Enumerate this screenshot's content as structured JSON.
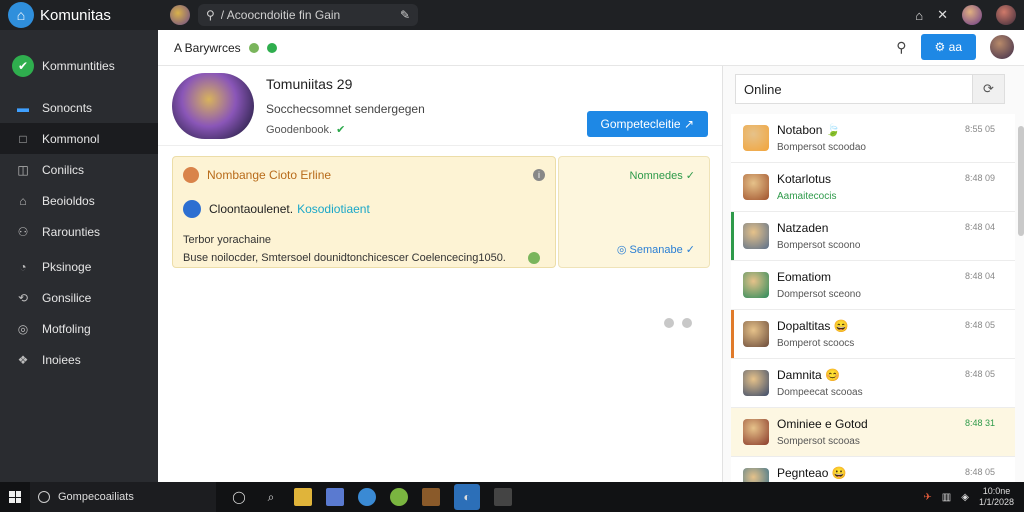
{
  "app": {
    "title": "Komunitas"
  },
  "topbar": {
    "search_placeholder": "/ Acoocndoitie fin Gain",
    "icons": [
      "home-icon",
      "pin-icon",
      "profile-avatar",
      "user-avatar"
    ]
  },
  "sidebar": {
    "header": "Kommuntities",
    "items": [
      {
        "label": "Sonocnts",
        "icon": "monitor-icon"
      },
      {
        "label": "Kommonol",
        "icon": "square-icon"
      },
      {
        "label": "Conilics",
        "icon": "chat-icon"
      },
      {
        "label": "Beoioldos",
        "icon": "bag-icon"
      },
      {
        "label": "Rarounties",
        "icon": "people-icon"
      },
      {
        "label": "Pksinoge",
        "icon": "message-icon"
      },
      {
        "label": "Gonsilice",
        "icon": "share-icon"
      },
      {
        "label": "Motfoling",
        "icon": "globe-icon"
      },
      {
        "label": "Inoiees",
        "icon": "grid-icon"
      }
    ]
  },
  "subbar": {
    "breadcrumb": "A Barywrces",
    "action_label": "⚙ aa"
  },
  "profile": {
    "name": "Tomuniitas 29",
    "subtitle": "Socchecsomnet sendergegen",
    "status": "Goodenbook.",
    "button": "Gompetecleitie"
  },
  "notice": {
    "title": "Nombange Cioto Erline",
    "row2_text": "Cloontaoulenet.",
    "row2_link": "Kosodiotiaent",
    "body_line1": "Terbor yorachaine",
    "body_line2": "Buse noilocder, Smtersoel dounidtonchicescer Coelencecing1050.",
    "side_ok": "Nomnedes ✓",
    "side_schedule": "◎ Semanabe ✓"
  },
  "friends_panel": {
    "search_value": "Online",
    "friends": [
      {
        "name": "Notabon",
        "emoji": "🍃",
        "status": "Bompersot scoodao",
        "time": "8:55 05",
        "bar": "",
        "color": "#f2a43a"
      },
      {
        "name": "Kotarlotus",
        "emoji": "",
        "status": "Aamaitecocis",
        "time": "8:48 09",
        "bar": "",
        "color": "#a0522d",
        "status_green": true
      },
      {
        "name": "Natzaden",
        "emoji": "",
        "status": "Bompersot scoono",
        "time": "8:48 04",
        "bar": "#2e9a4a",
        "color": "#5a6f8a"
      },
      {
        "name": "Eomatiom",
        "emoji": "",
        "status": "Dompersot sceono",
        "time": "8:48 04",
        "bar": "",
        "color": "#2a8a5a"
      },
      {
        "name": "Dopaltitas",
        "emoji": "😄",
        "status": "Bomperot scoocs",
        "time": "8:48 05",
        "bar": "#e07a2a",
        "color": "#6a4a3a"
      },
      {
        "name": "Damnita",
        "emoji": "😊",
        "status": "Dompeecat scooas",
        "time": "8:48 05",
        "bar": "",
        "color": "#3a4a6a"
      },
      {
        "name": "Ominiee e Gotod",
        "emoji": "",
        "status": "Sompersot scooas",
        "time": "8:48 31",
        "bar": "",
        "color": "#8a3a2a",
        "time_green": true
      },
      {
        "name": "Pegnteao",
        "emoji": "😀",
        "status": "Sompersot scooas",
        "time": "8:48 05",
        "bar": "",
        "color": "#2a6a8a"
      }
    ]
  },
  "taskbar": {
    "search": "Gompecoailiats",
    "clock_time": "10:0ne",
    "clock_date": "1/1/2028"
  },
  "colors": {
    "accent": "#1e88e5",
    "online": "#2e9a4a",
    "notice_bg": "#fdf3d4"
  }
}
